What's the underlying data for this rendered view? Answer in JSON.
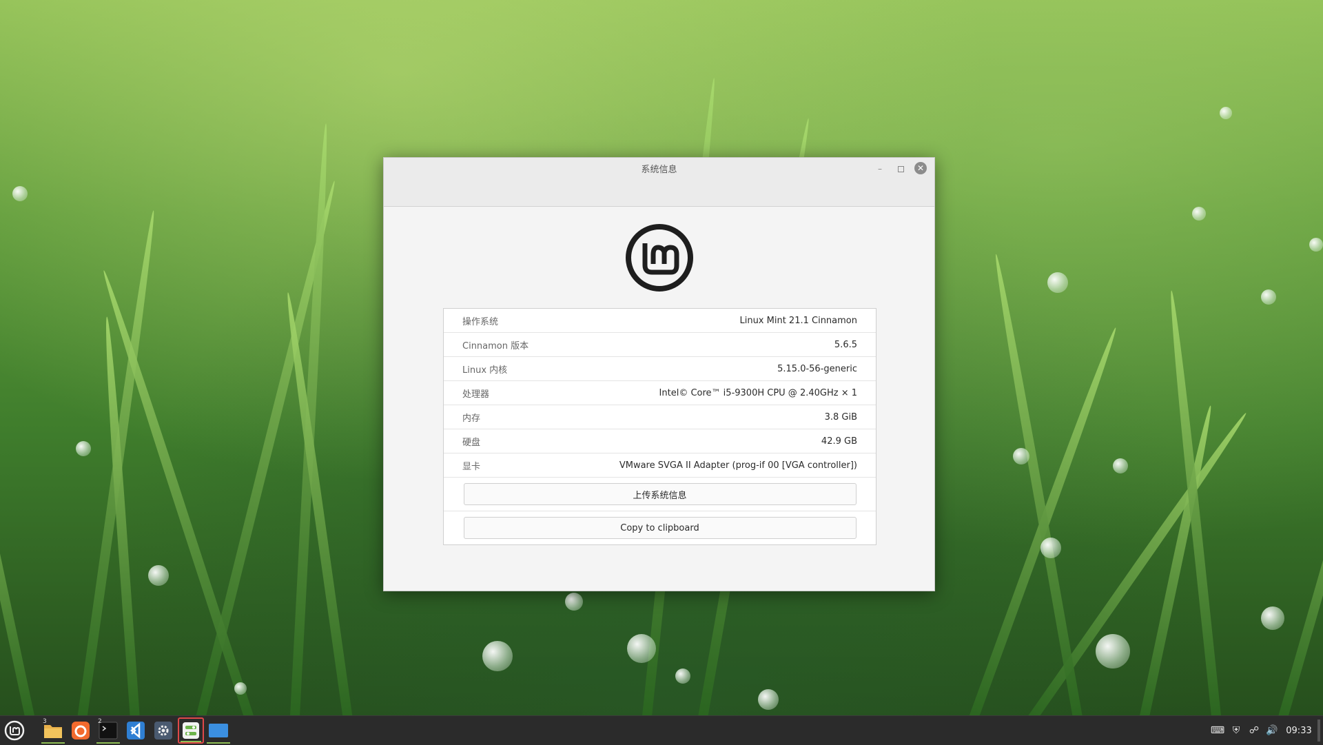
{
  "window": {
    "title": "系统信息"
  },
  "info_rows": [
    {
      "key": "操作系统",
      "value": "Linux Mint 21.1 Cinnamon"
    },
    {
      "key": "Cinnamon 版本",
      "value": "5.6.5"
    },
    {
      "key": "Linux 内核",
      "value": "5.15.0-56-generic"
    },
    {
      "key": "处理器",
      "value": "Intel© Core™ i5-9300H CPU @ 2.40GHz × 1"
    },
    {
      "key": "内存",
      "value": "3.8 GiB"
    },
    {
      "key": "硬盘",
      "value": "42.9 GB"
    },
    {
      "key": "显卡",
      "value": "VMware SVGA II Adapter (prog-if 00 [VGA controller])"
    }
  ],
  "buttons": {
    "upload": "上传系统信息",
    "copy": "Copy to clipboard"
  },
  "taskbar": {
    "files_badge": "3",
    "terminal_badge": "2",
    "clock": "09:33"
  },
  "colors": {
    "taskbar": "#2b2b2b",
    "accent": "#8fbf55",
    "firefox": "#f26a2e",
    "vscode": "#2f7fd3"
  }
}
